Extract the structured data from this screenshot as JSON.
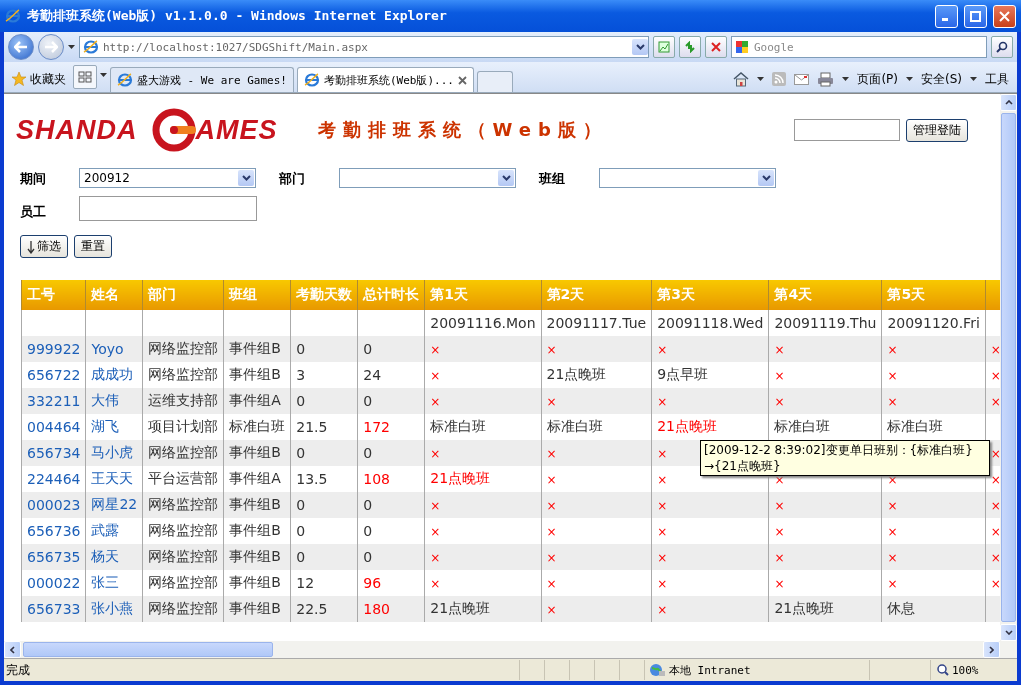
{
  "window": {
    "title": "考勤排班系统(Web版) v1.1.0.0 - Windows Internet Explorer"
  },
  "address_bar": {
    "url": "http://localhost:1027/SDGShift/Main.aspx"
  },
  "search": {
    "placeholder": "Google"
  },
  "favorites": {
    "label": "收藏夹"
  },
  "tabs": [
    {
      "label": "盛大游戏 - We are Games!",
      "selected": false
    },
    {
      "label": "考勤排班系统(Web版)...",
      "selected": true
    }
  ],
  "command_bar": [
    "页面(P)",
    "安全(S)",
    "工具"
  ],
  "page": {
    "logo": {
      "left": "SHANDA",
      "right": "AMES"
    },
    "title": "考勤排班系统（Web版）",
    "admin_button": "管理登陆",
    "filters": [
      {
        "label": "期间",
        "kind": "select",
        "value": "200912"
      },
      {
        "label": "部门",
        "kind": "select"
      },
      {
        "label": "班组",
        "kind": "select"
      },
      {
        "label": "员工",
        "kind": "text"
      }
    ],
    "buttons": [
      {
        "label": "筛选",
        "kind": "filter"
      },
      {
        "label": "重置",
        "kind": "reset"
      }
    ]
  },
  "table": {
    "columns": [
      "工号",
      "姓名",
      "部门",
      "班组",
      "考勤天数",
      "总计时长",
      "第1天",
      "第2天",
      "第3天",
      "第4天",
      "第5天"
    ],
    "dates": [
      "20091116.Mon",
      "20091117.Tue",
      "20091118.Wed",
      "20091119.Thu",
      "20091120.Fri"
    ],
    "rows": [
      {
        "id": "999922",
        "name": "Yoyo",
        "dept": "网络监控部",
        "group": "事件组B",
        "days_worked": "0",
        "hours": "0",
        "hours_alert": false,
        "days": [
          {
            "text": "×",
            "kind": "off"
          },
          {
            "text": "×",
            "kind": "off"
          },
          {
            "text": "×",
            "kind": "off"
          },
          {
            "text": "×",
            "kind": "off"
          },
          {
            "text": "×",
            "kind": "off"
          },
          {
            "text": "×",
            "kind": "off"
          }
        ]
      },
      {
        "id": "656722",
        "name": "成成功",
        "dept": "网络监控部",
        "group": "事件组B",
        "days_worked": "3",
        "hours": "24",
        "hours_alert": false,
        "days": [
          {
            "text": "×",
            "kind": "off"
          },
          {
            "text": "21点晚班",
            "kind": "shift"
          },
          {
            "text": "9点早班",
            "kind": "shift"
          },
          {
            "text": "×",
            "kind": "off"
          },
          {
            "text": "×",
            "kind": "off"
          },
          {
            "text": "×",
            "kind": "off"
          }
        ]
      },
      {
        "id": "332211",
        "name": "大伟",
        "dept": "运维支持部",
        "group": "事件组A",
        "days_worked": "0",
        "hours": "0",
        "hours_alert": false,
        "days": [
          {
            "text": "×",
            "kind": "off"
          },
          {
            "text": "×",
            "kind": "off"
          },
          {
            "text": "×",
            "kind": "off"
          },
          {
            "text": "×",
            "kind": "off"
          },
          {
            "text": "×",
            "kind": "off"
          },
          {
            "text": "×",
            "kind": "off"
          }
        ]
      },
      {
        "id": "004464",
        "name": "湖飞",
        "dept": "项目计划部",
        "group": "标准白班",
        "days_worked": "21.5",
        "hours": "172",
        "hours_alert": true,
        "days": [
          {
            "text": "标准白班",
            "kind": "shift"
          },
          {
            "text": "标准白班",
            "kind": "shift"
          },
          {
            "text": "21点晚班",
            "kind": "changed"
          },
          {
            "text": "标准白班",
            "kind": "shift"
          },
          {
            "text": "标准白班",
            "kind": "shift"
          },
          {
            "kind": "hidden"
          }
        ]
      },
      {
        "id": "656734",
        "name": "马小虎",
        "dept": "网络监控部",
        "group": "事件组B",
        "days_worked": "0",
        "hours": "0",
        "hours_alert": false,
        "days": [
          {
            "text": "×",
            "kind": "off"
          },
          {
            "text": "×",
            "kind": "off"
          },
          {
            "text": "×",
            "kind": "off"
          },
          {
            "kind": "hidden"
          },
          {
            "kind": "hidden"
          },
          {
            "text": "×",
            "kind": "off"
          }
        ]
      },
      {
        "id": "224464",
        "name": "王天天",
        "dept": "平台运营部",
        "group": "事件组A",
        "days_worked": "13.5",
        "hours": "108",
        "hours_alert": true,
        "days": [
          {
            "text": "21点晚班",
            "kind": "changed"
          },
          {
            "text": "×",
            "kind": "off"
          },
          {
            "text": "×",
            "kind": "off"
          },
          {
            "text": "×",
            "kind": "off"
          },
          {
            "text": "×",
            "kind": "off"
          },
          {
            "text": "×",
            "kind": "off"
          }
        ]
      },
      {
        "id": "000023",
        "name": "网星22",
        "dept": "网络监控部",
        "group": "事件组B",
        "days_worked": "0",
        "hours": "0",
        "hours_alert": false,
        "days": [
          {
            "text": "×",
            "kind": "off"
          },
          {
            "text": "×",
            "kind": "off"
          },
          {
            "text": "×",
            "kind": "off"
          },
          {
            "text": "×",
            "kind": "off"
          },
          {
            "text": "×",
            "kind": "off"
          },
          {
            "text": "×",
            "kind": "off"
          }
        ]
      },
      {
        "id": "656736",
        "name": "武露",
        "dept": "网络监控部",
        "group": "事件组B",
        "days_worked": "0",
        "hours": "0",
        "hours_alert": false,
        "days": [
          {
            "text": "×",
            "kind": "off"
          },
          {
            "text": "×",
            "kind": "off"
          },
          {
            "text": "×",
            "kind": "off"
          },
          {
            "text": "×",
            "kind": "off"
          },
          {
            "text": "×",
            "kind": "off"
          },
          {
            "text": "×",
            "kind": "off"
          }
        ]
      },
      {
        "id": "656735",
        "name": "杨天",
        "dept": "网络监控部",
        "group": "事件组B",
        "days_worked": "0",
        "hours": "0",
        "hours_alert": false,
        "days": [
          {
            "text": "×",
            "kind": "off"
          },
          {
            "text": "×",
            "kind": "off"
          },
          {
            "text": "×",
            "kind": "off"
          },
          {
            "text": "×",
            "kind": "off"
          },
          {
            "text": "×",
            "kind": "off"
          },
          {
            "text": "×",
            "kind": "off"
          }
        ]
      },
      {
        "id": "000022",
        "name": "张三",
        "dept": "网络监控部",
        "group": "事件组B",
        "days_worked": "12",
        "hours": "96",
        "hours_alert": true,
        "days": [
          {
            "text": "×",
            "kind": "off"
          },
          {
            "text": "×",
            "kind": "off"
          },
          {
            "text": "×",
            "kind": "off"
          },
          {
            "text": "×",
            "kind": "off"
          },
          {
            "text": "×",
            "kind": "off"
          },
          {
            "text": "×",
            "kind": "off"
          }
        ]
      },
      {
        "id": "656733",
        "name": "张小燕",
        "dept": "网络监控部",
        "group": "事件组B",
        "days_worked": "22.5",
        "hours": "180",
        "hours_alert": true,
        "days": [
          {
            "text": "21点晚班",
            "kind": "shift"
          },
          {
            "text": "×",
            "kind": "off"
          },
          {
            "text": "×",
            "kind": "off"
          },
          {
            "text": "21点晚班",
            "kind": "shift"
          },
          {
            "text": "休息",
            "kind": "shift"
          },
          {
            "kind": "hidden"
          }
        ]
      }
    ]
  },
  "tooltip": "[2009-12-2 8:39:02]变更单日班别：{标准白班}→{21点晚班}",
  "status_bar": {
    "text": "完成",
    "zone": "本地 Intranet",
    "zoom": "100%"
  }
}
